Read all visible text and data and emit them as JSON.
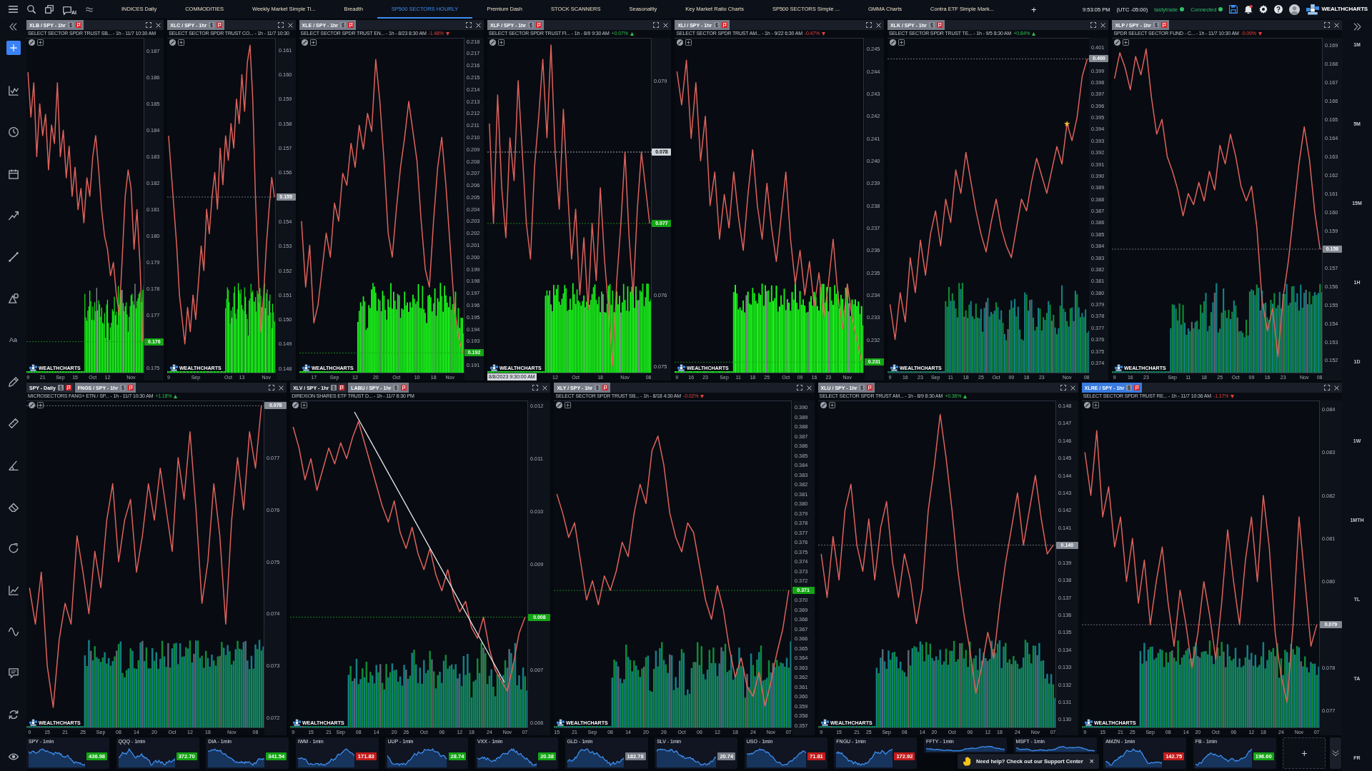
{
  "top_bar": {
    "ai_label": "AI",
    "tabs": [
      {
        "label": "INDICES Daily",
        "selected": false
      },
      {
        "label": "COMMODITIES",
        "selected": false
      },
      {
        "label": "Weekly Market Simple Ti...",
        "selected": false
      },
      {
        "label": "Breadth",
        "selected": false
      },
      {
        "label": "SP500 SECTORS HOURLY",
        "selected": true
      },
      {
        "label": "Premium Dash",
        "selected": false
      },
      {
        "label": "STOCK SCANNERS",
        "selected": false
      },
      {
        "label": "Seasonality",
        "selected": false
      },
      {
        "label": "Key Market Ratio Charts",
        "selected": false
      },
      {
        "label": "SP500 SECTORS Simple ...",
        "selected": false
      },
      {
        "label": "GMMA Charts",
        "selected": false
      },
      {
        "label": "Contra ETF Simple Mark...",
        "selected": false
      }
    ],
    "add_tab": "+",
    "clock": "9:53:05 PM",
    "timezone": "(UTC -05:00)",
    "connections": [
      {
        "label": "tastytrade",
        "connected": true
      },
      {
        "label": "Connected",
        "connected": true
      }
    ],
    "brand": "WEALTHCHARTS"
  },
  "left_toolbar": {
    "text_tool": "Aa"
  },
  "timeframes": [
    {
      "label": "1M",
      "selected": false
    },
    {
      "label": "5M",
      "selected": false
    },
    {
      "label": "15M",
      "selected": false
    },
    {
      "label": "1H",
      "selected": false
    },
    {
      "label": "1D",
      "selected": false
    },
    {
      "label": "1W",
      "selected": false
    },
    {
      "label": "1MTH",
      "selected": false
    },
    {
      "label": "TL",
      "selected": false
    },
    {
      "label": "TA",
      "selected": false
    },
    {
      "label": "FR",
      "selected": false
    }
  ],
  "chart_rows": [
    {
      "panels": [
        {
          "tabs": [
            {
              "label": "XLB / SPY - 1hr",
              "selected": true
            }
          ],
          "focused": false,
          "title": "SELECT SECTOR SPDR TRUST SB... - 1h - 11/7 10:30 AM",
          "kind": "bright",
          "logo": "WEALTHCHARTS",
          "chart_data": {
            "type": "line",
            "ylim": [
              0.1748,
              0.1875
            ],
            "yticks": [
              0.187,
              0.186,
              0.185,
              0.184,
              0.183,
              0.182,
              0.181,
              {
                "value": 0.18,
                "label": "0.180"
              },
              0.179,
              0.178,
              0.177,
              0.175
            ],
            "ref_lines": [
              {
                "axis": "y",
                "value": 0.176,
                "label": "0.176",
                "color": "#14a514"
              }
            ],
            "categories": [
              "9",
              null,
              null,
              null,
              null,
              "21",
              null,
              null,
              null,
              null,
              null,
              "Sep",
              null,
              null,
              null,
              null,
              "15",
              null,
              null,
              null,
              null,
              null,
              "Oct",
              null,
              null,
              null,
              null,
              "12",
              null,
              null,
              null,
              null,
              null,
              null,
              null,
              "Nov",
              null,
              null,
              null,
              null
            ],
            "values": [
              0.1862,
              0.1845,
              0.1858,
              0.183,
              0.185,
              0.1838,
              0.1846,
              0.1825,
              0.1842,
              0.1835,
              0.1858,
              0.183,
              0.184,
              0.1822,
              0.1834,
              0.1815,
              0.1826,
              0.181,
              0.1818,
              0.1805,
              0.1822,
              0.1815,
              0.183,
              0.1838,
              0.1825,
              0.181,
              0.18,
              0.1795,
              0.1785,
              0.179,
              0.1778,
              0.177,
              0.1792,
              0.1815,
              0.1825,
              0.1818,
              0.1795,
              0.181,
              0.179,
              0.176
            ]
          }
        },
        {
          "tabs": [
            {
              "label": "XLC / SPY - 1hr",
              "selected": true
            }
          ],
          "focused": false,
          "title": "SELECT SECTOR SPDR TRUST CO... - 1h - 11/7 10:30",
          "kind": "bright",
          "logo": "WEALTHCHARTS",
          "chart_data": {
            "type": "line",
            "ylim": [
              0.1478,
              0.1615
            ],
            "yticks": [
              0.161,
              {
                "value": 0.16,
                "label": "0.160"
              },
              0.159,
              0.158,
              0.157,
              0.156,
              0.154,
              0.153,
              0.152,
              0.151,
              {
                "value": 0.15,
                "label": "0.150"
              },
              0.149,
              0.148
            ],
            "ref_lines": [
              {
                "axis": "y",
                "value": 0.155,
                "label": "0.155",
                "color": "#858b94"
              }
            ],
            "categories": [
              "9",
              null,
              null,
              null,
              null,
              null,
              null,
              null,
              null,
              null,
              "Sep",
              null,
              null,
              null,
              null,
              null,
              null,
              null,
              null,
              null,
              null,
              null,
              "Oct",
              null,
              null,
              null,
              null,
              "13",
              null,
              null,
              null,
              null,
              null,
              null,
              null,
              null,
              "Nov",
              null,
              null,
              null
            ],
            "values": [
              0.1575,
              0.156,
              0.1545,
              0.153,
              0.151,
              0.15,
              0.149,
              0.1505,
              0.1495,
              0.151,
              0.15,
              0.1515,
              0.153,
              0.152,
              0.1545,
              0.1535,
              0.155,
              0.156,
              0.1545,
              0.157,
              0.1555,
              0.1575,
              0.1565,
              0.158,
              0.157,
              0.159,
              0.158,
              0.16,
              0.1585,
              0.1605,
              0.1612,
              0.159,
              0.155,
              0.152,
              0.1495,
              0.151,
              0.153,
              0.1545,
              0.1558,
              0.155
            ]
          }
        },
        {
          "tabs": [
            {
              "label": "XLE / SPY - 1hr",
              "selected": true
            }
          ],
          "focused": false,
          "title": "SELECT SECTOR SPDR TRUST EN... - 1h - 8/23 8:30 AM",
          "change": {
            "label": "-1.48%",
            "kind": "down"
          },
          "kind": "bright",
          "logo": "WEALTHCHARTS",
          "chart_data": {
            "type": "line",
            "ylim": [
              0.1903,
              0.2183
            ],
            "yticks": [
              0.218,
              0.217,
              0.216,
              0.215,
              0.214,
              0.213,
              0.212,
              0.211,
              {
                "value": 0.21,
                "label": "0.210"
              },
              0.209,
              0.208,
              0.207,
              0.206,
              0.205,
              0.204,
              0.203,
              0.202,
              0.201,
              {
                "value": 0.2,
                "label": "0.200"
              },
              0.199,
              0.198,
              0.197,
              0.196,
              0.195,
              0.194,
              0.193,
              0.191
            ],
            "ref_lines": [
              {
                "axis": "y",
                "value": 0.192,
                "label": "0.192",
                "color": "#14a514"
              }
            ],
            "categories": [
              null,
              null,
              null,
              "17",
              null,
              null,
              null,
              null,
              "Sep",
              null,
              null,
              null,
              null,
              "12",
              null,
              null,
              null,
              null,
              "20",
              null,
              null,
              null,
              null,
              "Oct",
              null,
              null,
              null,
              null,
              "10",
              null,
              null,
              null,
              "18",
              null,
              null,
              null,
              "Nov",
              null,
              null,
              null
            ],
            "values": [
              0.203,
              0.1975,
              0.201,
              0.1945,
              0.196,
              0.199,
              0.202,
              0.2,
              0.2045,
              0.203,
              0.207,
              0.206,
              0.2095,
              0.2075,
              0.211,
              0.209,
              0.212,
              0.2105,
              0.2165,
              0.213,
              0.208,
              0.202,
              0.2,
              0.204,
              0.2075,
              0.21,
              0.213,
              0.2105,
              0.208,
              0.203,
              0.199,
              0.1975,
              0.203,
              0.2075,
              0.21,
              0.206,
              0.201,
              0.196,
              0.1935,
              0.192
            ]
          }
        },
        {
          "tabs": [
            {
              "label": "XLF / SPY - 1hr",
              "selected": true
            }
          ],
          "focused": false,
          "title": "SELECT SECTOR SPDR TRUST FI... - 1h - 8/9 9:30 AM",
          "change": {
            "label": "+0.07%",
            "kind": "up"
          },
          "kind": "bright",
          "logo": "WEALTHCHARTS",
          "crosshair_time": "8/8/2023 9:30:00 AM",
          "chart_data": {
            "type": "line",
            "ylim": [
              0.0749,
              0.0796
            ],
            "yticks": [
              0.079,
              0.076,
              0.075
            ],
            "ref_lines": [
              {
                "axis": "y",
                "value": 0.078,
                "label": "0.078",
                "color": "#cfd3da"
              },
              {
                "axis": "y",
                "value": 0.077,
                "label": "0.077",
                "color": "#14a514"
              }
            ],
            "categories": [
              null,
              null,
              null,
              null,
              null,
              null,
              null,
              null,
              null,
              null,
              null,
              null,
              null,
              null,
              null,
              null,
              "12",
              null,
              null,
              null,
              null,
              "Oct",
              null,
              null,
              null,
              null,
              null,
              "18",
              null,
              null,
              null,
              null,
              null,
              "Nov",
              null,
              null,
              null,
              null,
              null,
              "08"
            ],
            "values": [
              0.0784,
              0.077,
              0.0788,
              0.0775,
              0.0768,
              0.0782,
              0.0776,
              0.079,
              0.078,
              0.077,
              0.0765,
              0.0778,
              0.0785,
              0.0793,
              0.0782,
              0.0795,
              0.078,
              0.0772,
              0.0786,
              0.0775,
              0.0765,
              0.0772,
              0.076,
              0.0768,
              0.0758,
              0.077,
              0.0762,
              0.0775,
              0.0765,
              0.0758,
              0.075,
              0.0762,
              0.077,
              0.078,
              0.0768,
              0.076,
              0.0772,
              0.078,
              0.0775,
              0.077
            ]
          }
        },
        {
          "tabs": [
            {
              "label": "XLI / SPY - 1hr",
              "selected": true
            }
          ],
          "focused": false,
          "title": "SELECT SECTOR SPDR TRUST AM... - 1h - 9/22 6:30 AM",
          "change": {
            "label": "-0.47%",
            "kind": "down"
          },
          "kind": "bright",
          "logo": "WEALTHCHARTS",
          "chart_data": {
            "type": "line",
            "ylim": [
              0.2305,
              0.2455
            ],
            "yticks": [
              0.245,
              0.244,
              0.243,
              0.242,
              0.241,
              {
                "value": 0.24,
                "label": "0.240"
              },
              0.239,
              0.238,
              0.237,
              0.236,
              0.235,
              0.234,
              0.233,
              0.232
            ],
            "ref_lines": [
              {
                "axis": "y",
                "value": 0.231,
                "label": "0.231",
                "color": "#14a514"
              }
            ],
            "categories": [
              "9",
              null,
              null,
              "16",
              null,
              null,
              "23",
              null,
              null,
              null,
              "Sep",
              null,
              null,
              "11",
              null,
              null,
              "18",
              null,
              null,
              "25",
              null,
              null,
              null,
              "Oct",
              null,
              null,
              "09",
              null,
              null,
              "16",
              null,
              null,
              "23",
              null,
              null,
              null,
              "Nov",
              null,
              null,
              null
            ],
            "values": [
              0.244,
              0.2425,
              0.2445,
              0.241,
              0.2435,
              0.24,
              0.242,
              0.238,
              0.2395,
              0.2365,
              0.2385,
              0.237,
              0.2395,
              0.2375,
              0.236,
              0.2385,
              0.2405,
              0.238,
              0.2365,
              0.239,
              0.237,
              0.2355,
              0.2375,
              0.2395,
              0.2365,
              0.2345,
              0.236,
              0.234,
              0.2355,
              0.2335,
              0.235,
              0.233,
              0.2345,
              0.2365,
              0.234,
              0.2325,
              0.2345,
              0.233,
              0.232,
              0.231
            ]
          }
        },
        {
          "tabs": [
            {
              "label": "XLK / SPY - 1hr",
              "selected": true
            }
          ],
          "focused": false,
          "title": "SELECT SECTOR SPDR TRUST TE... - 1h - 9/5 8:30 AM",
          "change": {
            "label": "+0.84%",
            "kind": "up"
          },
          "kind": "dim",
          "logo": "WEALTHCHARTS",
          "chart_data": {
            "type": "line",
            "ylim": [
              0.3731,
              0.4018
            ],
            "yticks": [
              0.401,
              0.399,
              0.398,
              0.397,
              0.396,
              0.395,
              0.394,
              0.393,
              0.392,
              0.391,
              {
                "value": 0.39,
                "label": "0.390"
              },
              0.389,
              0.388,
              0.387,
              0.386,
              0.385,
              0.384,
              0.383,
              0.382,
              0.381,
              {
                "value": 0.38,
                "label": "0.380"
              },
              0.379,
              0.378,
              0.377,
              0.376,
              0.375,
              0.374
            ],
            "ref_lines": [
              {
                "axis": "y",
                "value": 0.4,
                "label": "0.400",
                "color": "#858b94"
              }
            ],
            "annotations": [
              {
                "x": "Nov",
                "y": 0.3945,
                "text": "★"
              }
            ],
            "categories": [
              "9",
              null,
              null,
              "16",
              null,
              null,
              "23",
              null,
              null,
              "Sep",
              null,
              null,
              "11",
              null,
              null,
              "18",
              null,
              null,
              "25",
              null,
              null,
              "Oct",
              null,
              null,
              "09",
              null,
              null,
              "16",
              null,
              null,
              "23",
              null,
              null,
              null,
              null,
              "Nov",
              null,
              null,
              null,
              "08"
            ],
            "values": [
              0.379,
              0.376,
              0.38,
              0.3775,
              0.383,
              0.38,
              0.3845,
              0.3815,
              0.385,
              0.387,
              0.384,
              0.388,
              0.386,
              0.3905,
              0.3885,
              0.392,
              0.3895,
              0.387,
              0.385,
              0.3835,
              0.386,
              0.388,
              0.3855,
              0.384,
              0.383,
              0.3855,
              0.388,
              0.387,
              0.3895,
              0.3915,
              0.39,
              0.3885,
              0.3905,
              0.3925,
              0.391,
              0.3945,
              0.393,
              0.395,
              0.3985,
              0.4
            ]
          }
        },
        {
          "tabs": [
            {
              "label": "XLP / SPY - 1hr",
              "selected": true
            }
          ],
          "focused": false,
          "title": "SPDR SELECT SECTOR FUND - C... - 1h - 11/7 10:30 AM",
          "change": {
            "label": "-0.09%",
            "kind": "down"
          },
          "kind": "dim",
          "logo": "WEALTHCHARTS",
          "chart_data": {
            "type": "line",
            "ylim": [
              0.1513,
              0.1694
            ],
            "yticks": [
              0.169,
              0.168,
              0.167,
              0.166,
              0.165,
              0.164,
              0.163,
              0.162,
              0.161,
              {
                "value": 0.16,
                "label": "0.160"
              },
              0.159,
              0.157,
              0.156,
              0.155,
              0.154,
              0.153,
              0.152
            ],
            "ref_lines": [
              {
                "axis": "y",
                "value": 0.158,
                "label": "0.158",
                "color": "#858b94"
              }
            ],
            "categories": [
              "9",
              null,
              null,
              "16",
              null,
              null,
              "23",
              null,
              null,
              null,
              null,
              "Sep",
              null,
              null,
              "11",
              null,
              null,
              "18",
              null,
              null,
              "25",
              null,
              null,
              "Oct",
              null,
              null,
              "09",
              null,
              null,
              "16",
              null,
              null,
              "23",
              null,
              null,
              null,
              "Nov",
              null,
              null,
              "08"
            ],
            "values": [
              0.1672,
              0.1686,
              0.1678,
              0.1666,
              0.1684,
              0.1674,
              0.1688,
              0.1662,
              0.1642,
              0.165,
              0.163,
              0.1622,
              0.1612,
              0.1598,
              0.161,
              0.1604,
              0.1616,
              0.1606,
              0.1622,
              0.1612,
              0.1636,
              0.1626,
              0.1642,
              0.163,
              0.1614,
              0.1606,
              0.1614,
              0.1592,
              0.1552,
              0.1536,
              0.1548,
              0.1522,
              0.1554,
              0.1574,
              0.16,
              0.1626,
              0.1646,
              0.1628,
              0.16,
              0.158
            ]
          }
        }
      ]
    },
    {
      "panels": [
        {
          "tabs": [
            {
              "label": "SPY - Daily",
              "selected": false
            },
            {
              "label": "FNGS / SPY - 1hr",
              "selected": true
            }
          ],
          "focused": false,
          "title": "MICROSECTORS FANG+ ETN / SP... - 1h - 11/7 10:30 AM",
          "change": {
            "label": "+1.18%",
            "kind": "up"
          },
          "kind": "dim",
          "logo": "WEALTHCHARTS",
          "chart_data": {
            "type": "line",
            "ylim": [
              0.0718,
              0.0781
            ],
            "yticks": [
              0.077,
              0.076,
              0.075,
              0.074,
              0.073,
              0.072
            ],
            "ref_lines": [
              {
                "axis": "y",
                "value": 0.078,
                "label": "0.078",
                "color": "#858b94"
              }
            ],
            "categories": [
              "9",
              null,
              null,
              "15",
              null,
              null,
              "21",
              null,
              null,
              "25",
              null,
              null,
              "Sep",
              null,
              null,
              "08",
              null,
              null,
              "14",
              null,
              null,
              "20",
              null,
              null,
              "Oct",
              null,
              null,
              "12",
              null,
              null,
              "18",
              null,
              null,
              null,
              "Nov",
              null,
              null,
              null,
              "08",
              null
            ],
            "values": [
              0.0745,
              0.0738,
              0.0748,
              0.073,
              0.0722,
              0.0735,
              0.0742,
              0.0738,
              0.0755,
              0.0748,
              0.074,
              0.0752,
              0.0745,
              0.0758,
              0.0765,
              0.075,
              0.0758,
              0.0762,
              0.0748,
              0.0755,
              0.0765,
              0.0758,
              0.0768,
              0.076,
              0.0752,
              0.077,
              0.0762,
              0.0775,
              0.076,
              0.0742,
              0.075,
              0.0765,
              0.0755,
              0.0738,
              0.0758,
              0.077,
              0.076,
              0.0775,
              0.0768,
              0.078
            ]
          }
        },
        {
          "tabs": [
            {
              "label": "XLV / SPY - 1hr",
              "selected": false
            },
            {
              "label": "LABU / SPY - 1hr",
              "selected": true
            }
          ],
          "focused": false,
          "title": "DIREXION SHARES ETF TRUST D... - 1h - 11/7 8:30 PM",
          "kind": "dim",
          "logo": "WEALTHCHARTS",
          "trendline": true,
          "chart_data": {
            "type": "line",
            "ylim": [
              0.0059,
              0.0121
            ],
            "yticks": [
              0.012,
              0.011,
              {
                "value": 0.01,
                "label": "0.010"
              },
              0.009,
              0.007,
              0.006
            ],
            "ref_lines": [
              {
                "axis": "y",
                "value": 0.008,
                "label": "0.008",
                "color": "#14a514"
              }
            ],
            "categories": [
              "9",
              null,
              null,
              "15",
              null,
              null,
              "21",
              null,
              "Sep",
              null,
              null,
              "08",
              null,
              null,
              "14",
              null,
              null,
              "20",
              null,
              "26",
              null,
              null,
              "Oct",
              null,
              null,
              "06",
              null,
              null,
              "12",
              null,
              "18",
              null,
              null,
              "24",
              null,
              null,
              "Nov",
              null,
              null,
              "07"
            ],
            "values": [
              0.0116,
              0.0112,
              0.0106,
              0.011,
              0.0104,
              0.0108,
              0.0112,
              0.0109,
              0.0113,
              0.011,
              0.0114,
              0.0117,
              0.0113,
              0.0109,
              0.0105,
              0.0101,
              0.0098,
              0.0102,
              0.0096,
              0.0093,
              0.0097,
              0.0092,
              0.0089,
              0.0093,
              0.0088,
              0.0085,
              0.0089,
              0.0084,
              0.0081,
              0.0083,
              0.0078,
              0.0076,
              0.008,
              0.0074,
              0.007,
              0.0068,
              0.0066,
              0.0071,
              0.0077,
              0.008
            ]
          }
        },
        {
          "tabs": [
            {
              "label": "XLY / SPY - 1hr",
              "selected": true
            }
          ],
          "focused": false,
          "title": "SELECT SECTOR SPDR TRUST SB... - 1h - 8/18 4:30 AM",
          "change": {
            "label": "-0.02%",
            "kind": "down"
          },
          "kind": "dim",
          "logo": "WEALTHCHARTS",
          "chart_data": {
            "type": "line",
            "ylim": [
              0.3567,
              0.3907
            ],
            "yticks": [
              {
                "value": 0.39,
                "label": "0.390"
              },
              0.389,
              0.388,
              0.387,
              0.386,
              0.385,
              0.384,
              0.383,
              0.382,
              0.381,
              {
                "value": 0.38,
                "label": "0.380"
              },
              0.379,
              0.378,
              0.377,
              0.376,
              0.375,
              0.374,
              0.373,
              0.372,
              {
                "value": 0.37,
                "label": "0.370"
              },
              0.369,
              0.368,
              0.367,
              0.366,
              0.365,
              0.364,
              0.363,
              0.362,
              0.361,
              {
                "value": 0.36,
                "label": "0.360"
              },
              0.359,
              0.358,
              0.357
            ],
            "ref_lines": [
              {
                "axis": "y",
                "value": 0.371,
                "label": "0.371",
                "color": "#14a514"
              }
            ],
            "categories": [
              "15",
              null,
              null,
              "21",
              null,
              null,
              "Sep",
              null,
              null,
              "08",
              null,
              null,
              "14",
              null,
              null,
              "20",
              null,
              null,
              "26",
              null,
              null,
              "Oct",
              null,
              null,
              "06",
              null,
              null,
              "12",
              null,
              null,
              "18",
              null,
              null,
              "24",
              null,
              null,
              "Nov",
              null,
              null,
              "07"
            ],
            "values": [
              0.381,
              0.379,
              0.3765,
              0.378,
              0.374,
              0.37,
              0.372,
              0.3695,
              0.3725,
              0.371,
              0.373,
              0.376,
              0.3745,
              0.379,
              0.382,
              0.38,
              0.3855,
              0.387,
              0.384,
              0.379,
              0.3765,
              0.375,
              0.378,
              0.377,
              0.3735,
              0.37,
              0.368,
              0.3715,
              0.369,
              0.365,
              0.362,
              0.364,
              0.361,
              0.36,
              0.3625,
              0.359,
              0.3615,
              0.3645,
              0.367,
              0.371
            ]
          }
        },
        {
          "tabs": [
            {
              "label": "XLU / SPY - 1hr",
              "selected": true
            }
          ],
          "focused": false,
          "title": "SELECT SECTOR SPDR TRUST AM... - 1h - 8/9 8:30 AM",
          "change": {
            "label": "+0.36%",
            "kind": "up"
          },
          "kind": "dim",
          "logo": "WEALTHCHARTS",
          "chart_data": {
            "type": "line",
            "ylim": [
              0.1295,
              0.1483
            ],
            "yticks": [
              0.148,
              0.147,
              0.146,
              0.145,
              0.144,
              0.143,
              0.142,
              0.141,
              0.139,
              0.138,
              0.137,
              0.136,
              0.135,
              0.134,
              0.133,
              0.132,
              0.131,
              {
                "value": 0.13,
                "label": "0.130"
              }
            ],
            "ref_lines": [
              {
                "axis": "y",
                "value": 0.14,
                "label": "0.140",
                "color": "#858b94"
              }
            ],
            "categories": [
              "9",
              null,
              null,
              "15",
              null,
              null,
              "21",
              null,
              "25",
              null,
              null,
              "Sep",
              null,
              null,
              "08",
              null,
              null,
              "14",
              null,
              "20",
              null,
              null,
              "Oct",
              null,
              null,
              "06",
              null,
              null,
              "12",
              null,
              "18",
              null,
              null,
              "24",
              null,
              null,
              "Nov",
              null,
              null,
              "07"
            ],
            "values": [
              0.1395,
              0.137,
              0.1405,
              0.138,
              0.142,
              0.1435,
              0.14,
              0.1385,
              0.1415,
              0.138,
              0.141,
              0.1425,
              0.139,
              0.137,
              0.1395,
              0.138,
              0.1355,
              0.1375,
              0.142,
              0.1445,
              0.1475,
              0.145,
              0.142,
              0.1385,
              0.136,
              0.134,
              0.1315,
              0.133,
              0.135,
              0.1335,
              0.1365,
              0.139,
              0.141,
              0.143,
              0.14,
              0.142,
              0.144,
              0.1415,
              0.1395,
              0.14
            ]
          }
        },
        {
          "tabs": [
            {
              "label": "XLRE / SPY - 1hr",
              "selected": true
            }
          ],
          "focused": true,
          "title": "SELECT SECTOR SPDR TRUST RE... - 1h - 11/7 10:36 AM",
          "change": {
            "label": "-1.17%",
            "kind": "down"
          },
          "kind": "dim",
          "logo": "WEALTHCHARTS",
          "chart_data": {
            "type": "line",
            "ylim": [
              0.0766,
              0.0842
            ],
            "yticks": [
              0.084,
              0.083,
              0.082,
              0.081,
              {
                "value": 0.08,
                "label": "0.080"
              },
              0.078,
              0.077
            ],
            "ref_lines": [
              {
                "axis": "y",
                "value": 0.079,
                "label": "0.079",
                "color": "#858b94"
              }
            ],
            "categories": [
              "9",
              null,
              null,
              "15",
              null,
              null,
              "21",
              null,
              "25",
              null,
              null,
              "Sep",
              null,
              null,
              "08",
              null,
              null,
              "14",
              null,
              "20",
              null,
              null,
              "Oct",
              null,
              null,
              "06",
              null,
              null,
              "12",
              null,
              "18",
              null,
              null,
              "24",
              null,
              null,
              "Nov",
              null,
              null,
              "07"
            ],
            "values": [
              0.083,
              0.082,
              0.0835,
              0.0815,
              0.0822,
              0.0808,
              0.0815,
              0.08,
              0.081,
              0.0795,
              0.0805,
              0.079,
              0.08,
              0.0808,
              0.0795,
              0.0785,
              0.0798,
              0.079,
              0.078,
              0.0788,
              0.08,
              0.0792,
              0.0782,
              0.0795,
              0.0812,
              0.08,
              0.079,
              0.0805,
              0.0815,
              0.08,
              0.082,
              0.0808,
              0.0788,
              0.0778,
              0.0772,
              0.079,
              0.0815,
              0.08,
              0.0785,
              0.079
            ]
          }
        }
      ]
    }
  ],
  "tickers": [
    {
      "label": "SPY - 1min",
      "price": "436.98",
      "color": "#14a514"
    },
    {
      "label": "QQQ - 1min",
      "price": "372.70",
      "color": "#14a514"
    },
    {
      "label": "DIA - 1min",
      "price": "341.54",
      "color": "#14a514"
    },
    {
      "label": "IWM - 1min",
      "price": "171.83",
      "color": "#c41c1c"
    },
    {
      "label": "UUP - 1min",
      "price": "28.74",
      "color": "#14a514"
    },
    {
      "label": "VXX - 1min",
      "price": "20.38",
      "color": "#14a514"
    },
    {
      "label": "GLD - 1min",
      "price": "182.78",
      "color": "#787e87"
    },
    {
      "label": "SLV - 1min",
      "price": "20.74",
      "color": "#787e87"
    },
    {
      "label": "USO - 1min",
      "price": "71.81",
      "color": "#c41c1c"
    },
    {
      "label": "FNGU - 1min",
      "price": "172.92",
      "color": "#c41c1c"
    },
    {
      "label": "FFTY - 1min"
    },
    {
      "label": "MSFT - 1min"
    },
    {
      "label": "AMZN - 1min",
      "price": "142.75",
      "color": "#c41c1c"
    },
    {
      "label": "FB - 1min",
      "price": "196.60",
      "color": "#14a514"
    }
  ],
  "add_chart": "+",
  "toast": {
    "message": "Need help? Check out our Support Center",
    "close": "×"
  }
}
